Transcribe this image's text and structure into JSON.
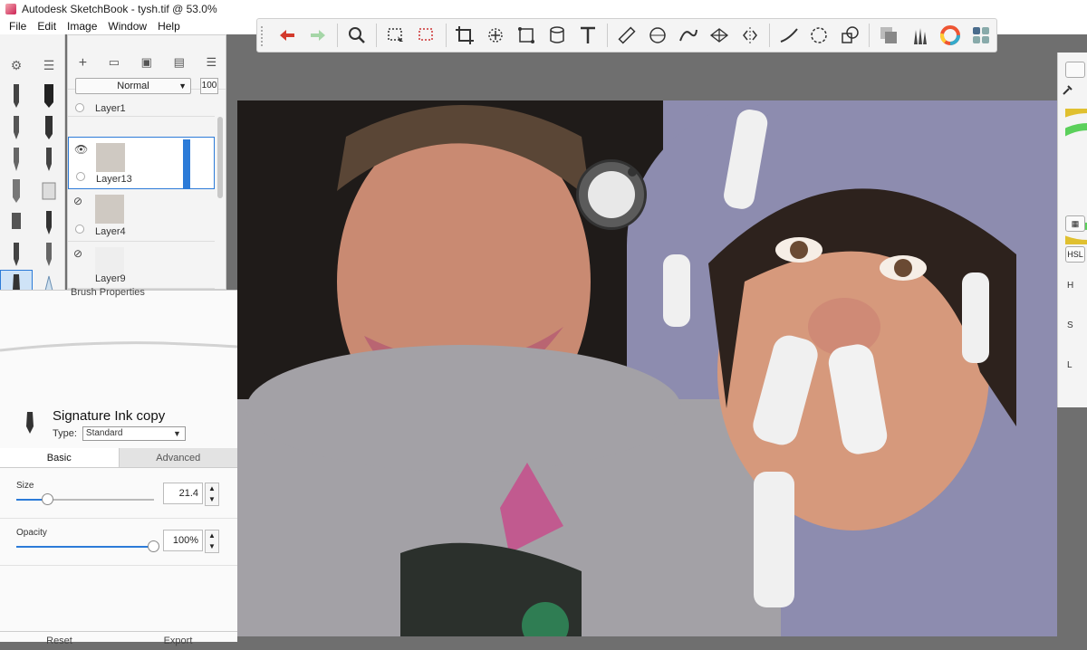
{
  "window": {
    "title": "Autodesk SketchBook - tysh.tif @ 53.0%"
  },
  "menu": [
    "File",
    "Edit",
    "Image",
    "Window",
    "Help"
  ],
  "toolbar": {
    "icons": [
      "undo-icon",
      "redo-icon",
      "zoom-icon",
      "select-rect-icon",
      "select-lasso-icon",
      "crop-icon",
      "transform-icon",
      "distort-icon",
      "fill-icon",
      "text-icon",
      "ruler-icon",
      "ellipse-guide-icon",
      "french-curve-icon",
      "perspective-icon",
      "symmetry-icon",
      "line-icon",
      "ellipse-icon",
      "shape-icon",
      "layer-editor-icon",
      "brush-library-icon",
      "color-wheel-icon",
      "panels-icon"
    ]
  },
  "layers": {
    "blend_mode": "Normal",
    "opacity": "100",
    "items": [
      {
        "name": "Layer1"
      },
      {
        "name": "Layer13"
      },
      {
        "name": "Layer4"
      },
      {
        "name": "Layer9"
      }
    ]
  },
  "brush_properties": {
    "title": "Brush Properties",
    "name": "Signature Ink copy",
    "type_label": "Type:",
    "type_value": "Standard",
    "tabs": {
      "basic": "Basic",
      "advanced": "Advanced"
    },
    "size": {
      "label": "Size",
      "value": "21.4",
      "fraction": 0.23
    },
    "opacity": {
      "label": "Opacity",
      "value": "100%",
      "fraction": 1.0
    },
    "footer": {
      "reset": "Reset",
      "export": "Export"
    }
  },
  "color_panel": {
    "mode": "HSL",
    "h": "H",
    "s": "S",
    "l": "L"
  }
}
